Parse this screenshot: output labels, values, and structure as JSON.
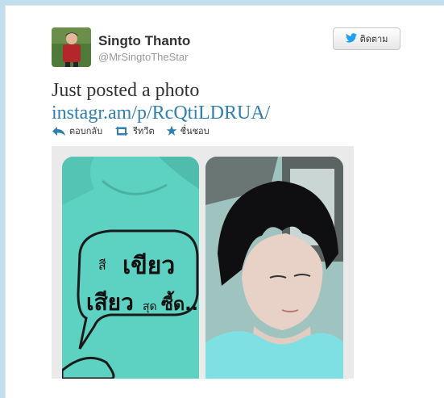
{
  "profile": {
    "name": "Singto Thanto",
    "handle": "@MrSingtoTheStar",
    "avatar_icon": "profile-photo"
  },
  "follow_button": {
    "label": "ติดตาม",
    "icon": "twitter-bird-icon",
    "color": "#1da1f2"
  },
  "tweet": {
    "text": "Just posted a photo",
    "link_text": "instagr.am/p/RcQtiLDRUA/"
  },
  "actions": [
    {
      "label": "ตอบกลับ",
      "icon": "reply-icon"
    },
    {
      "label": "รีทวีต",
      "icon": "retweet-icon"
    },
    {
      "label": "ชื่นชอบ",
      "icon": "star-icon"
    }
  ],
  "photo_shirt_text": {
    "line1_small": "สี",
    "line1_big": "เขียว",
    "line2_big": "เสียว",
    "line2_small": "สุด",
    "line2_end": "ซี้ด..."
  },
  "colors": {
    "accent": "#2f7fb0",
    "background": "#c0deed",
    "shirt": "#5ed2c2"
  }
}
